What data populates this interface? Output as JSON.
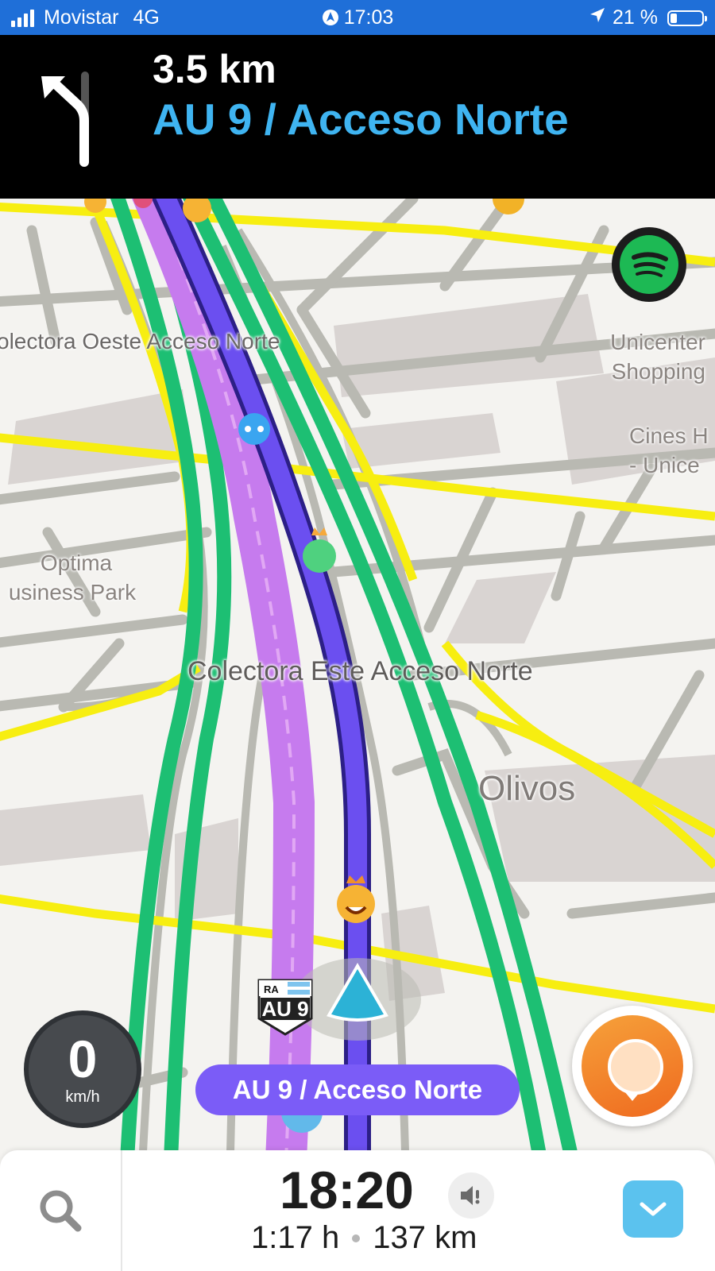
{
  "status_bar": {
    "carrier": "Movistar",
    "network": "4G",
    "time": "17:03",
    "battery_percent": "21 %",
    "icons": [
      "signal-icon",
      "nav-active-icon",
      "location-arrow-icon",
      "battery-icon"
    ]
  },
  "navigation": {
    "distance": "3.5 km",
    "next_street": "AU 9 / Acceso Norte",
    "turn_icon": "keep-left-arrow-icon"
  },
  "map": {
    "labels": {
      "colectora_oeste": "olectora Oeste Acceso Norte",
      "colectora_este": "Colectora Este Acceso Norte",
      "olivos": "Olivos",
      "unicenter_1": "Unicenter",
      "unicenter_2": "Shopping",
      "cines_1": "Cines H",
      "cines_2": "- Unice",
      "optima_1": "Optima",
      "optima_2": "usiness Park"
    },
    "current_street": "AU 9 / Acceso Norte",
    "route_shield": {
      "country": "RA",
      "route": "AU 9"
    },
    "colors": {
      "route": "#6b4ff0",
      "route_edge": "#2c1f86",
      "lane_purple": "#c67bee",
      "highway_green": "#1dbf73",
      "major_yellow": "#f7ee11",
      "minor_road": "#b9b9b2",
      "accent_blue": "#3fb4f1"
    }
  },
  "speedometer": {
    "value": "0",
    "unit": "km/h"
  },
  "bottom_bar": {
    "eta": "18:20",
    "duration": "1:17 h",
    "distance": "137 km"
  }
}
